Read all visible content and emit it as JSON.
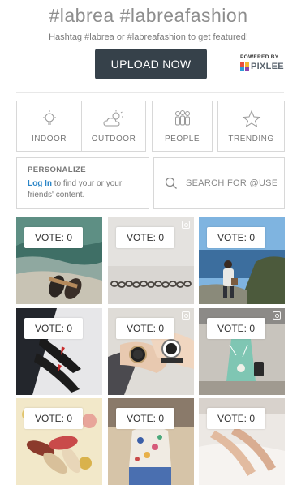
{
  "header": {
    "title": "#labrea  #labreafashion",
    "subtitle": "Hashtag #labrea or #labreafashion to get featured!",
    "upload_label": "UPLOAD NOW",
    "powered_label": "POWERED BY",
    "brand_label": "PIXLEE"
  },
  "categories": [
    {
      "label": "INDOOR",
      "icon": "lightbulb-icon"
    },
    {
      "label": "OUTDOOR",
      "icon": "cloud-sun-icon"
    },
    {
      "label": "PEOPLE",
      "icon": "people-icon"
    },
    {
      "label": "TRENDING",
      "icon": "star-icon"
    }
  ],
  "personalize": {
    "title": "PERSONALIZE",
    "link_label": "Log In",
    "text": " to find your or your friends' content."
  },
  "search": {
    "placeholder": "SEARCH FOR @USE",
    "icon": "search-icon"
  },
  "photos": [
    {
      "vote_label": "VOTE: 0",
      "has_instagram": false,
      "scene": "sandals-by-ocean"
    },
    {
      "vote_label": "VOTE: 0",
      "has_instagram": true,
      "scene": "chain-bracelet"
    },
    {
      "vote_label": "VOTE: 0",
      "has_instagram": false,
      "scene": "woman-at-coast"
    },
    {
      "vote_label": "VOTE: 0",
      "has_instagram": false,
      "scene": "black-heels"
    },
    {
      "vote_label": "VOTE: 0",
      "has_instagram": true,
      "scene": "watches-on-wrists"
    },
    {
      "vote_label": "VOTE: 0",
      "has_instagram": true,
      "scene": "woman-with-coffee"
    },
    {
      "vote_label": "VOTE: 0",
      "has_instagram": false,
      "scene": "flat-shoes"
    },
    {
      "vote_label": "VOTE: 0",
      "has_instagram": false,
      "scene": "floral-top-outfit"
    },
    {
      "vote_label": "VOTE: 0",
      "has_instagram": false,
      "scene": "legs-on-sheets"
    }
  ],
  "colors": {
    "accent_dark": "#36414a",
    "link_blue": "#2a85c7",
    "border": "#d8d8d8"
  }
}
